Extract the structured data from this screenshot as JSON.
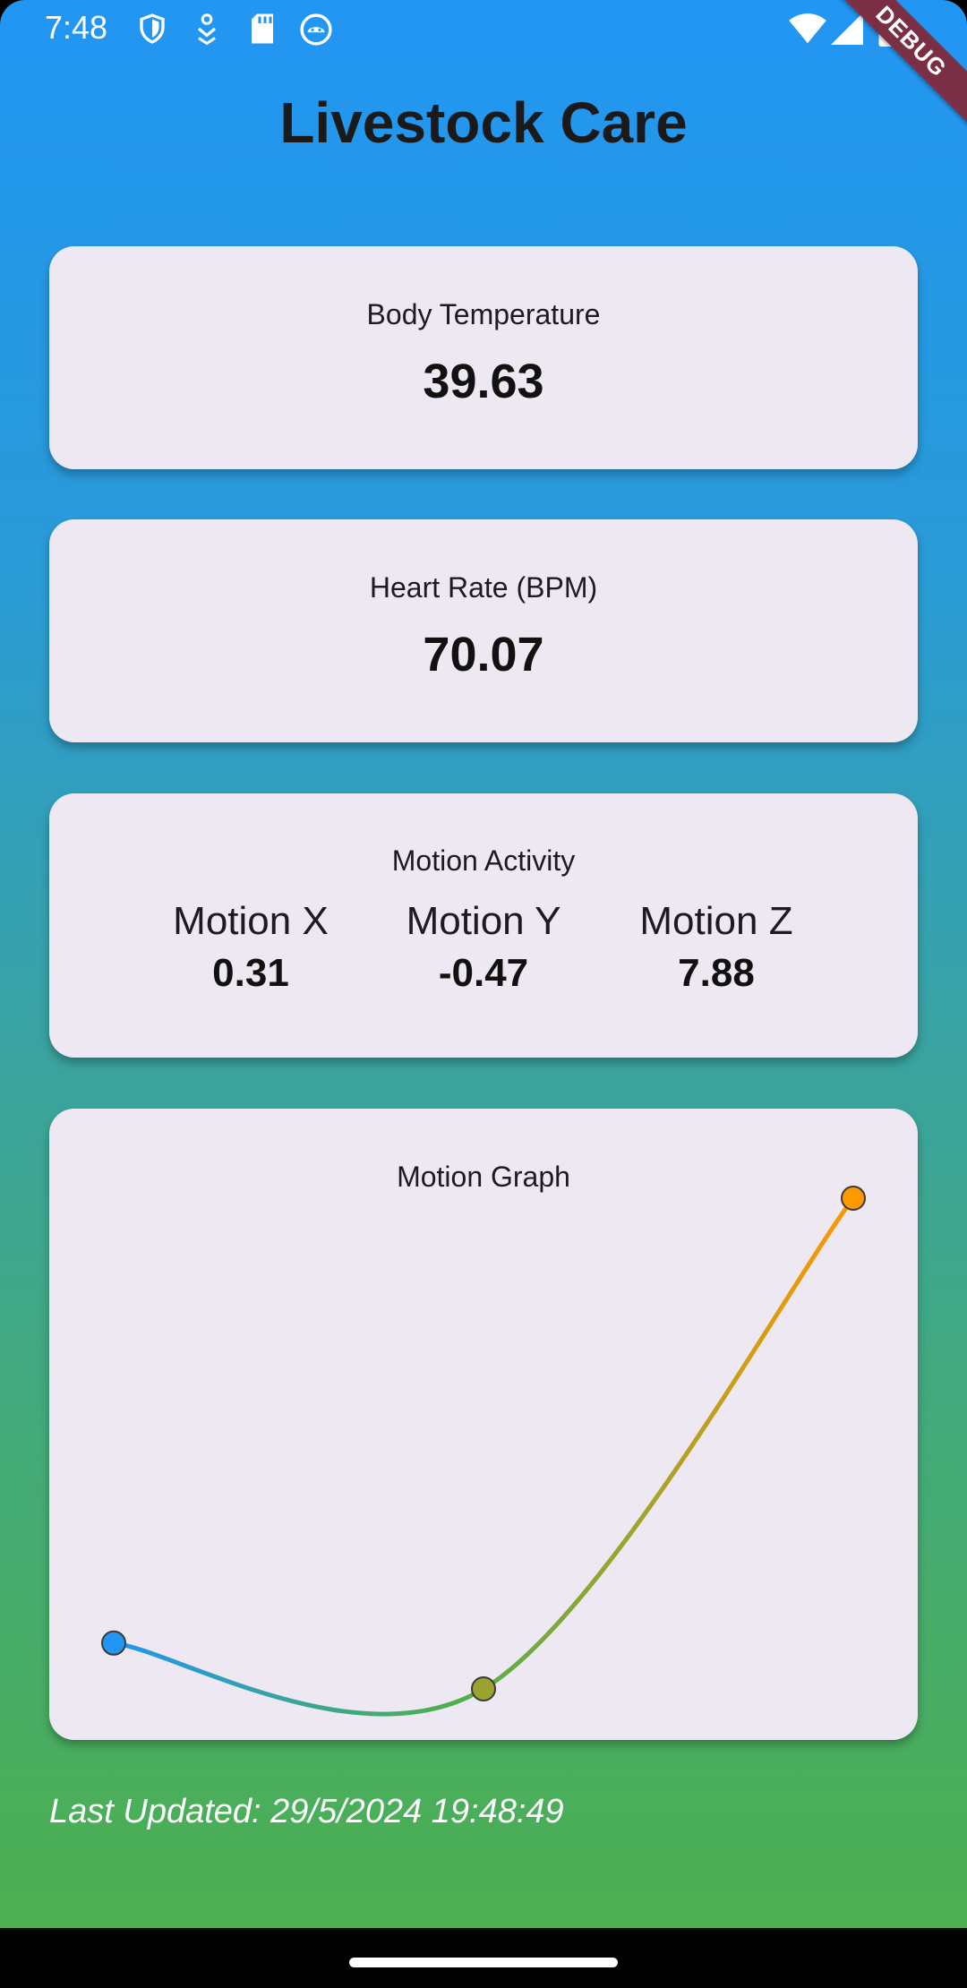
{
  "status_bar": {
    "time": "7:48",
    "icons_left": [
      "shield-icon",
      "download-icon",
      "sd-card-icon",
      "android-icon"
    ],
    "icons_right": [
      "wifi-icon",
      "signal-icon",
      "battery-icon"
    ]
  },
  "debug_banner": "DEBUG",
  "app": {
    "title": "Livestock Care"
  },
  "temperature": {
    "label": "Body Temperature",
    "value": "39.63"
  },
  "heart_rate": {
    "label": "Heart Rate (BPM)",
    "value": "70.07"
  },
  "motion": {
    "label": "Motion Activity",
    "axes": [
      {
        "name": "Motion X",
        "value": "0.31"
      },
      {
        "name": "Motion Y",
        "value": "-0.47"
      },
      {
        "name": "Motion Z",
        "value": "7.88"
      }
    ]
  },
  "chart_data": {
    "type": "line",
    "title": "Motion Graph",
    "x": [
      0,
      1,
      2
    ],
    "values": [
      0.31,
      -0.47,
      7.88
    ],
    "point_colors": [
      "#2196f3",
      "#9aa332",
      "#ff9800"
    ],
    "line_gradient": [
      "#2196f3",
      "#4caf50",
      "#ff9800"
    ],
    "curved": true,
    "grid": false,
    "axes_visible": false
  },
  "footer": {
    "last_updated": "Last Updated: 29/5/2024 19:48:49"
  },
  "colors": {
    "gradient_top": "#2196f3",
    "gradient_bottom": "#4caf50",
    "card_bg": "#eee8f3",
    "debug_ribbon": "#7a2f45"
  }
}
